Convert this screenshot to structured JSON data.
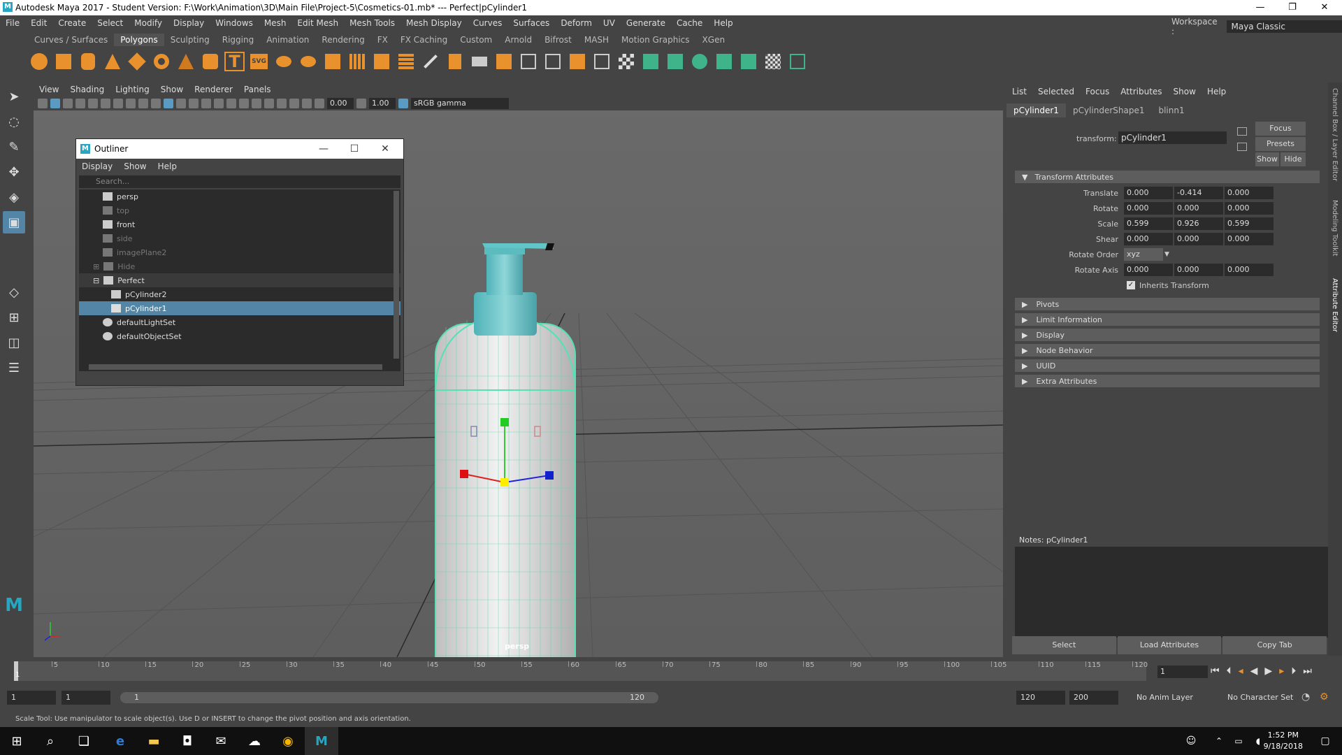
{
  "title_bar": {
    "logo": "M",
    "title": "Autodesk Maya 2017 - Student Version: F:\\Work\\Animation\\3D\\Main File\\Project-5\\Cosmetics-01.mb*   ---   Perfect|pCylinder1",
    "minimize": "—",
    "maximize": "❐",
    "close": "✕"
  },
  "menu_bar": {
    "items": [
      "File",
      "Edit",
      "Create",
      "Select",
      "Modify",
      "Display",
      "Windows",
      "Mesh",
      "Edit Mesh",
      "Mesh Tools",
      "Mesh Display",
      "Curves",
      "Surfaces",
      "Deform",
      "UV",
      "Generate",
      "Cache",
      "Help"
    ],
    "workspace_label": "Workspace :",
    "workspace_value": "Maya Classic"
  },
  "shelf": {
    "tabs": [
      "Curves / Surfaces",
      "Polygons",
      "Sculpting",
      "Rigging",
      "Animation",
      "Rendering",
      "FX",
      "FX Caching",
      "Custom",
      "Arnold",
      "Bifrost",
      "MASH",
      "Motion Graphics",
      "XGen"
    ],
    "active_tab": "Polygons",
    "text_icon": "T",
    "svg_icon": "SVG"
  },
  "viewport": {
    "menu": [
      "View",
      "Shading",
      "Lighting",
      "Show",
      "Renderer",
      "Panels"
    ],
    "field1": "0.00",
    "field2": "1.00",
    "gamma": "sRGB gamma",
    "camera_label": "persp"
  },
  "outliner": {
    "title": "Outliner",
    "menu": [
      "Display",
      "Show",
      "Help"
    ],
    "search_placeholder": "Search...",
    "items": [
      {
        "label": "persp"
      },
      {
        "label": "top"
      },
      {
        "label": "front"
      },
      {
        "label": "side"
      },
      {
        "label": "imagePlane2"
      },
      {
        "label": "Hide"
      },
      {
        "label": "Perfect"
      },
      {
        "label": "pCylinder2"
      },
      {
        "label": "pCylinder1"
      },
      {
        "label": "defaultLightSet"
      },
      {
        "label": "defaultObjectSet"
      }
    ]
  },
  "attribute_editor": {
    "menu": [
      "List",
      "Selected",
      "Focus",
      "Attributes",
      "Show",
      "Help"
    ],
    "tabs": [
      "pCylinder1",
      "pCylinderShape1",
      "blinn1"
    ],
    "transform_label": "transform:",
    "transform_value": "pCylinder1",
    "buttons": {
      "focus": "Focus",
      "presets": "Presets",
      "show": "Show",
      "hide": "Hide"
    },
    "section_transform": "Transform Attributes",
    "rows": [
      {
        "label": "Translate",
        "values": [
          "0.000",
          "-0.414",
          "0.000"
        ]
      },
      {
        "label": "Rotate",
        "values": [
          "0.000",
          "0.000",
          "0.000"
        ]
      },
      {
        "label": "Scale",
        "values": [
          "0.599",
          "0.926",
          "0.599"
        ]
      },
      {
        "label": "Shear",
        "values": [
          "0.000",
          "0.000",
          "0.000"
        ]
      }
    ],
    "rotate_order_label": "Rotate Order",
    "rotate_order_value": "xyz",
    "rotate_axis_label": "Rotate Axis",
    "rotate_axis_values": [
      "0.000",
      "0.000",
      "0.000"
    ],
    "inherits_label": "Inherits Transform",
    "sections": [
      "Pivots",
      "Limit Information",
      "Display",
      "Node Behavior",
      "UUID",
      "Extra Attributes"
    ],
    "notes_label": "Notes:  pCylinder1",
    "bottom_buttons": [
      "Select",
      "Load Attributes",
      "Copy Tab"
    ]
  },
  "side_strip": {
    "labels": [
      "Channel Box / Layer Editor",
      "Modeling Toolkit",
      "Attribute Editor"
    ]
  },
  "time_slider": {
    "ticks": [
      "5",
      "10",
      "15",
      "20",
      "25",
      "30",
      "35",
      "40",
      "45",
      "50",
      "55",
      "60",
      "65",
      "70",
      "75",
      "80",
      "85",
      "90",
      "95",
      "100",
      "105",
      "110",
      "115",
      "120"
    ],
    "current_frame_marker": "1",
    "current_frame": "1",
    "range_start": "1",
    "range_start2": "1",
    "range_inner_start": "1",
    "range_inner_end": "120",
    "range_end": "120",
    "range_end2": "200",
    "anim_layer": "No Anim Layer",
    "character_set": "No Character Set"
  },
  "help_line": "Scale Tool: Use manipulator to scale object(s). Use D or INSERT to change the pivot position and axis orientation.",
  "taskbar": {
    "time": "1:52 PM",
    "date": "9/18/2018"
  }
}
